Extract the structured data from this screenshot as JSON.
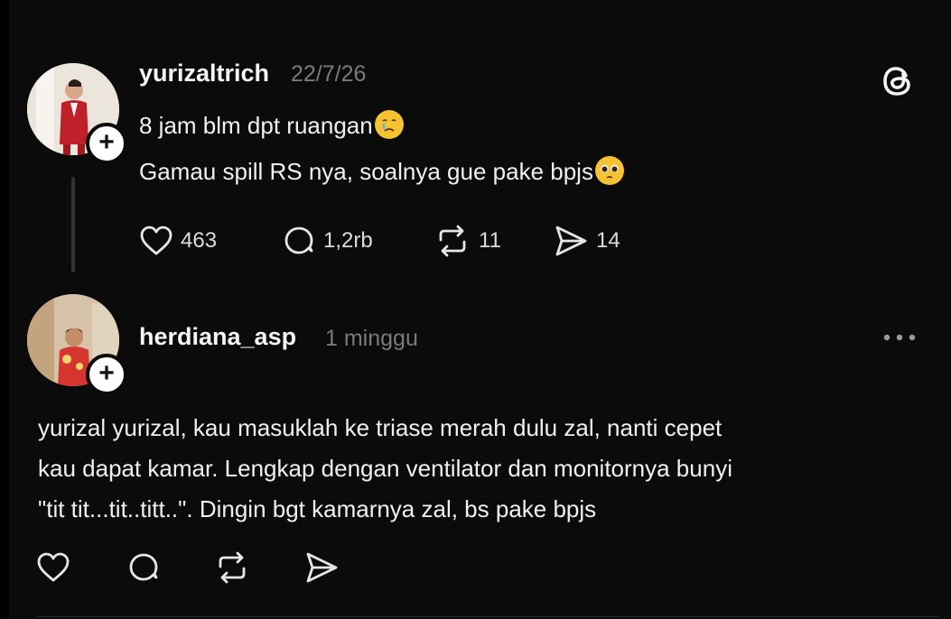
{
  "post": {
    "username": "yurizaltrich",
    "timestamp": "22/7/26",
    "lines": [
      "8 jam blm dpt ruangan",
      "Gamau spill RS nya, soalnya gue pake bpjs"
    ],
    "likes": "463",
    "replies": "1,2rb",
    "reposts": "11",
    "shares": "14"
  },
  "reply": {
    "username": "herdiana_asp",
    "timestamp": "1 minggu",
    "lines": [
      "yurizal yurizal, kau masuklah ke triase merah dulu zal, nanti cepet",
      "kau dapat kamar. Lengkap dengan ventilator dan monitornya bunyi",
      "\"tit tit...tit..titt..\". Dingin bgt kamarnya zal, bs pake bpjs"
    ]
  },
  "icons": {
    "logo": "threads-logo-icon",
    "like": "heart-icon",
    "reply": "comment-icon",
    "repost": "repost-icon",
    "share": "send-icon",
    "more": "more-icon",
    "follow": "plus-icon"
  },
  "colors": {
    "background": "#0b0b0b",
    "text": "#f2f2f2",
    "muted": "#7a7a7a",
    "emoji": "#f5c232"
  }
}
